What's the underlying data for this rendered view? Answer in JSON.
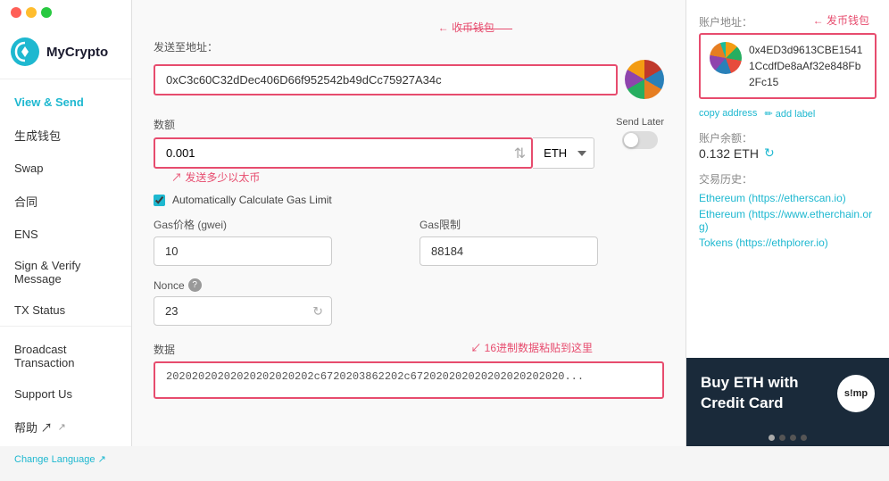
{
  "window": {
    "controls": [
      "close",
      "minimize",
      "maximize"
    ]
  },
  "sidebar": {
    "logo_text": "MyCrypto",
    "nav_items": [
      {
        "id": "view-send",
        "label": "View & Send",
        "active": true
      },
      {
        "id": "generate-wallet",
        "label": "生成钱包",
        "active": false
      },
      {
        "id": "swap",
        "label": "Swap",
        "active": false
      },
      {
        "id": "contract",
        "label": "合同",
        "active": false
      },
      {
        "id": "ens",
        "label": "ENS",
        "active": false
      },
      {
        "id": "sign-verify",
        "label": "Sign & Verify Message",
        "active": false
      },
      {
        "id": "tx-status",
        "label": "TX Status",
        "active": false
      },
      {
        "id": "broadcast",
        "label": "Broadcast Transaction",
        "active": false
      },
      {
        "id": "support",
        "label": "Support Us",
        "active": false
      },
      {
        "id": "help",
        "label": "帮助 ↗",
        "active": false
      },
      {
        "id": "change-language",
        "label": "Change Language ↗",
        "active": false
      }
    ]
  },
  "form": {
    "to_address_label": "发送至地址：",
    "to_address_value": "0xC3c60C32dDec406D66f952542b49dCc75927A34c",
    "to_address_annotation": "收币钱包",
    "amount_label": "数额",
    "amount_value": "0.001",
    "amount_annotation": "发送多少以太币",
    "currency": "ETH",
    "send_later_label": "Send Later",
    "auto_gas_label": "Automatically Calculate Gas Limit",
    "gas_price_label": "Gas价格 (gwei)",
    "gas_price_value": "10",
    "gas_limit_label": "Gas限制",
    "gas_limit_value": "88184",
    "nonce_label": "Nonce",
    "nonce_value": "23",
    "hex_annotation": "16进制数据粘贴到这里",
    "data_label": "数据",
    "data_value": "20202020202020202020202c6720203862202c672020202020202020202020..."
  },
  "right_panel": {
    "account_address_label": "账户地址：",
    "account_annotation": "发币钱包",
    "account_address": "0x4ED3d9613CBE15411CcdfDe8aAf32e848Fb2Fc15",
    "copy_label": "copy address",
    "add_label": "add label",
    "balance_label": "账户余额：",
    "balance_value": "0.132 ETH",
    "tx_history_label": "交易历史：",
    "tx_links": [
      "Ethereum (https://etherscan.io)",
      "Ethereum (https://www.etherchain.org)",
      "Tokens (https://ethplorer.io)"
    ]
  },
  "banner": {
    "line1": "Buy ETH with",
    "line2": "Credit Card",
    "logo_text": "s!mp",
    "dots": [
      true,
      false,
      false,
      false
    ]
  }
}
